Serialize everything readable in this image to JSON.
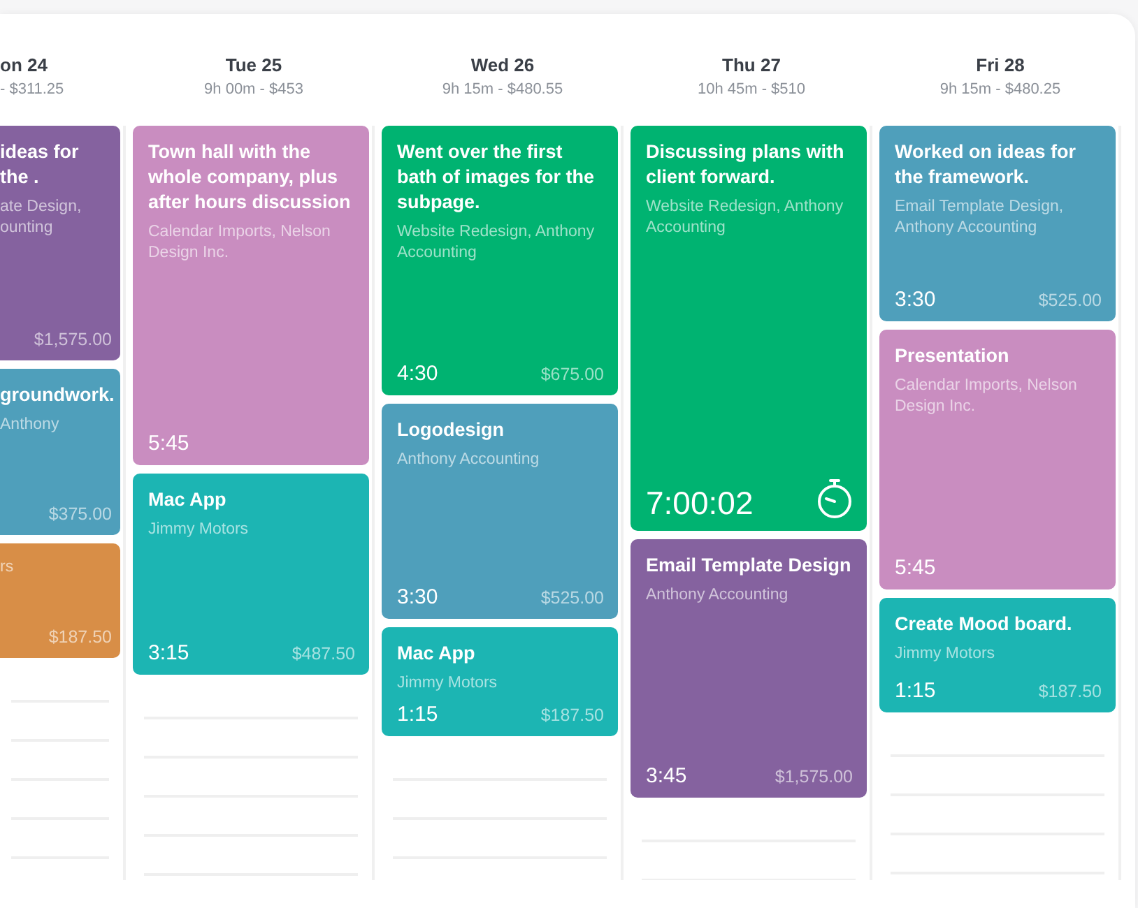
{
  "days": [
    {
      "label": "on 24",
      "summary": "- $311.25",
      "entries": [
        {
          "kind": "entry",
          "title": "ideas for the .",
          "subtitle": "ate Design, ounting",
          "amount": "$1,575.00",
          "color": "#85629f"
        },
        {
          "kind": "entry",
          "title": "groundwork.",
          "subtitle": "Anthony",
          "amount": "$375.00",
          "color": "#4f9fbb"
        },
        {
          "kind": "entry",
          "subtitle": "rs",
          "amount": "$187.50",
          "color": "#d88e47"
        }
      ]
    },
    {
      "label": "Tue 25",
      "summary": "9h 00m - $453",
      "entries": [
        {
          "kind": "entry",
          "title": "Town hall with the whole company, plus after hours discussion",
          "subtitle": "Calendar Imports, Nelson Design Inc.",
          "duration": "5:45",
          "color": "#c98dc0"
        },
        {
          "kind": "entry",
          "title": "Mac App",
          "subtitle": "Jimmy Motors",
          "duration": "3:15",
          "amount": "$487.50",
          "color": "#1cb5b3"
        }
      ]
    },
    {
      "label": "Wed 26",
      "summary": "9h 15m - $480.55",
      "entries": [
        {
          "kind": "entry",
          "title": "Went over the first bath of images for the subpage.",
          "subtitle": "Website Redesign, Anthony Accounting",
          "duration": "4:30",
          "amount": "$675.00",
          "color": "#00b371"
        },
        {
          "kind": "entry",
          "title": "Logodesign",
          "subtitle": "Anthony Accounting",
          "duration": "3:30",
          "amount": "$525.00",
          "color": "#4f9fbb"
        },
        {
          "kind": "entry",
          "title": "Mac App",
          "subtitle": "Jimmy Motors",
          "duration": "1:15",
          "amount": "$187.50",
          "color": "#1cb5b3"
        }
      ]
    },
    {
      "label": "Thu 27",
      "summary": "10h 45m - $510",
      "entries": [
        {
          "kind": "timer",
          "title": "Discussing plans with client forward.",
          "subtitle": "Website Redesign, Anthony Accounting",
          "duration": "7:00:02",
          "color": "#00b371"
        },
        {
          "kind": "entry",
          "title": "Email Template Design",
          "subtitle": "Anthony Accounting",
          "duration": "3:45",
          "amount": "$1,575.00",
          "color": "#85629f"
        }
      ]
    },
    {
      "label": "Fri 28",
      "summary": "9h 15m - $480.25",
      "entries": [
        {
          "kind": "entry",
          "title": "Worked on ideas for the framework.",
          "subtitle": "Email Template Design, Anthony Accounting",
          "duration": "3:30",
          "amount": "$525.00",
          "color": "#4f9fbb"
        },
        {
          "kind": "entry",
          "title": "Presentation",
          "subtitle": "Calendar Imports, Nelson Design Inc.",
          "duration": "5:45",
          "color": "#c98dc0"
        },
        {
          "kind": "entry",
          "title": "Create Mood board.",
          "subtitle": "Jimmy Motors",
          "duration": "1:15",
          "amount": "$187.50",
          "color": "#1cb5b3"
        }
      ]
    }
  ]
}
